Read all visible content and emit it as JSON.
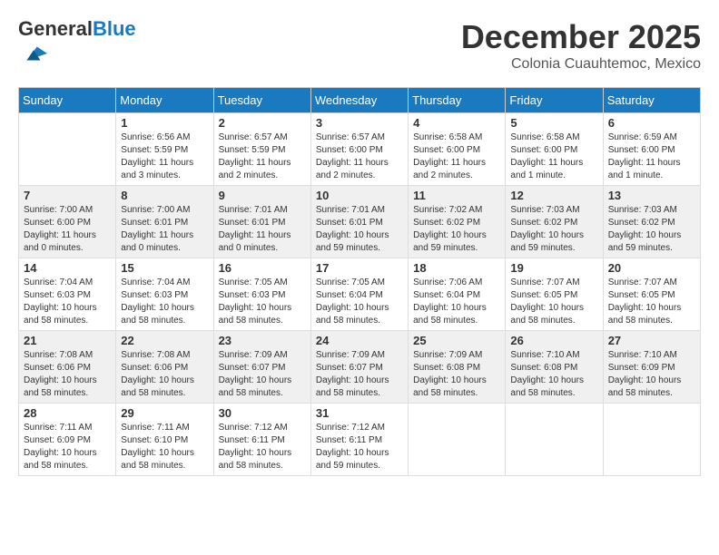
{
  "logo": {
    "general": "General",
    "blue": "Blue"
  },
  "header": {
    "month": "December 2025",
    "location": "Colonia Cuauhtemoc, Mexico"
  },
  "weekdays": [
    "Sunday",
    "Monday",
    "Tuesday",
    "Wednesday",
    "Thursday",
    "Friday",
    "Saturday"
  ],
  "weeks": [
    [
      {
        "day": "",
        "sunrise": "",
        "sunset": "",
        "daylight": ""
      },
      {
        "day": "1",
        "sunrise": "Sunrise: 6:56 AM",
        "sunset": "Sunset: 5:59 PM",
        "daylight": "Daylight: 11 hours and 3 minutes."
      },
      {
        "day": "2",
        "sunrise": "Sunrise: 6:57 AM",
        "sunset": "Sunset: 5:59 PM",
        "daylight": "Daylight: 11 hours and 2 minutes."
      },
      {
        "day": "3",
        "sunrise": "Sunrise: 6:57 AM",
        "sunset": "Sunset: 6:00 PM",
        "daylight": "Daylight: 11 hours and 2 minutes."
      },
      {
        "day": "4",
        "sunrise": "Sunrise: 6:58 AM",
        "sunset": "Sunset: 6:00 PM",
        "daylight": "Daylight: 11 hours and 2 minutes."
      },
      {
        "day": "5",
        "sunrise": "Sunrise: 6:58 AM",
        "sunset": "Sunset: 6:00 PM",
        "daylight": "Daylight: 11 hours and 1 minute."
      },
      {
        "day": "6",
        "sunrise": "Sunrise: 6:59 AM",
        "sunset": "Sunset: 6:00 PM",
        "daylight": "Daylight: 11 hours and 1 minute."
      }
    ],
    [
      {
        "day": "7",
        "sunrise": "Sunrise: 7:00 AM",
        "sunset": "Sunset: 6:00 PM",
        "daylight": "Daylight: 11 hours and 0 minutes."
      },
      {
        "day": "8",
        "sunrise": "Sunrise: 7:00 AM",
        "sunset": "Sunset: 6:01 PM",
        "daylight": "Daylight: 11 hours and 0 minutes."
      },
      {
        "day": "9",
        "sunrise": "Sunrise: 7:01 AM",
        "sunset": "Sunset: 6:01 PM",
        "daylight": "Daylight: 11 hours and 0 minutes."
      },
      {
        "day": "10",
        "sunrise": "Sunrise: 7:01 AM",
        "sunset": "Sunset: 6:01 PM",
        "daylight": "Daylight: 10 hours and 59 minutes."
      },
      {
        "day": "11",
        "sunrise": "Sunrise: 7:02 AM",
        "sunset": "Sunset: 6:02 PM",
        "daylight": "Daylight: 10 hours and 59 minutes."
      },
      {
        "day": "12",
        "sunrise": "Sunrise: 7:03 AM",
        "sunset": "Sunset: 6:02 PM",
        "daylight": "Daylight: 10 hours and 59 minutes."
      },
      {
        "day": "13",
        "sunrise": "Sunrise: 7:03 AM",
        "sunset": "Sunset: 6:02 PM",
        "daylight": "Daylight: 10 hours and 59 minutes."
      }
    ],
    [
      {
        "day": "14",
        "sunrise": "Sunrise: 7:04 AM",
        "sunset": "Sunset: 6:03 PM",
        "daylight": "Daylight: 10 hours and 58 minutes."
      },
      {
        "day": "15",
        "sunrise": "Sunrise: 7:04 AM",
        "sunset": "Sunset: 6:03 PM",
        "daylight": "Daylight: 10 hours and 58 minutes."
      },
      {
        "day": "16",
        "sunrise": "Sunrise: 7:05 AM",
        "sunset": "Sunset: 6:03 PM",
        "daylight": "Daylight: 10 hours and 58 minutes."
      },
      {
        "day": "17",
        "sunrise": "Sunrise: 7:05 AM",
        "sunset": "Sunset: 6:04 PM",
        "daylight": "Daylight: 10 hours and 58 minutes."
      },
      {
        "day": "18",
        "sunrise": "Sunrise: 7:06 AM",
        "sunset": "Sunset: 6:04 PM",
        "daylight": "Daylight: 10 hours and 58 minutes."
      },
      {
        "day": "19",
        "sunrise": "Sunrise: 7:07 AM",
        "sunset": "Sunset: 6:05 PM",
        "daylight": "Daylight: 10 hours and 58 minutes."
      },
      {
        "day": "20",
        "sunrise": "Sunrise: 7:07 AM",
        "sunset": "Sunset: 6:05 PM",
        "daylight": "Daylight: 10 hours and 58 minutes."
      }
    ],
    [
      {
        "day": "21",
        "sunrise": "Sunrise: 7:08 AM",
        "sunset": "Sunset: 6:06 PM",
        "daylight": "Daylight: 10 hours and 58 minutes."
      },
      {
        "day": "22",
        "sunrise": "Sunrise: 7:08 AM",
        "sunset": "Sunset: 6:06 PM",
        "daylight": "Daylight: 10 hours and 58 minutes."
      },
      {
        "day": "23",
        "sunrise": "Sunrise: 7:09 AM",
        "sunset": "Sunset: 6:07 PM",
        "daylight": "Daylight: 10 hours and 58 minutes."
      },
      {
        "day": "24",
        "sunrise": "Sunrise: 7:09 AM",
        "sunset": "Sunset: 6:07 PM",
        "daylight": "Daylight: 10 hours and 58 minutes."
      },
      {
        "day": "25",
        "sunrise": "Sunrise: 7:09 AM",
        "sunset": "Sunset: 6:08 PM",
        "daylight": "Daylight: 10 hours and 58 minutes."
      },
      {
        "day": "26",
        "sunrise": "Sunrise: 7:10 AM",
        "sunset": "Sunset: 6:08 PM",
        "daylight": "Daylight: 10 hours and 58 minutes."
      },
      {
        "day": "27",
        "sunrise": "Sunrise: 7:10 AM",
        "sunset": "Sunset: 6:09 PM",
        "daylight": "Daylight: 10 hours and 58 minutes."
      }
    ],
    [
      {
        "day": "28",
        "sunrise": "Sunrise: 7:11 AM",
        "sunset": "Sunset: 6:09 PM",
        "daylight": "Daylight: 10 hours and 58 minutes."
      },
      {
        "day": "29",
        "sunrise": "Sunrise: 7:11 AM",
        "sunset": "Sunset: 6:10 PM",
        "daylight": "Daylight: 10 hours and 58 minutes."
      },
      {
        "day": "30",
        "sunrise": "Sunrise: 7:12 AM",
        "sunset": "Sunset: 6:11 PM",
        "daylight": "Daylight: 10 hours and 58 minutes."
      },
      {
        "day": "31",
        "sunrise": "Sunrise: 7:12 AM",
        "sunset": "Sunset: 6:11 PM",
        "daylight": "Daylight: 10 hours and 59 minutes."
      },
      {
        "day": "",
        "sunrise": "",
        "sunset": "",
        "daylight": ""
      },
      {
        "day": "",
        "sunrise": "",
        "sunset": "",
        "daylight": ""
      },
      {
        "day": "",
        "sunrise": "",
        "sunset": "",
        "daylight": ""
      }
    ]
  ]
}
